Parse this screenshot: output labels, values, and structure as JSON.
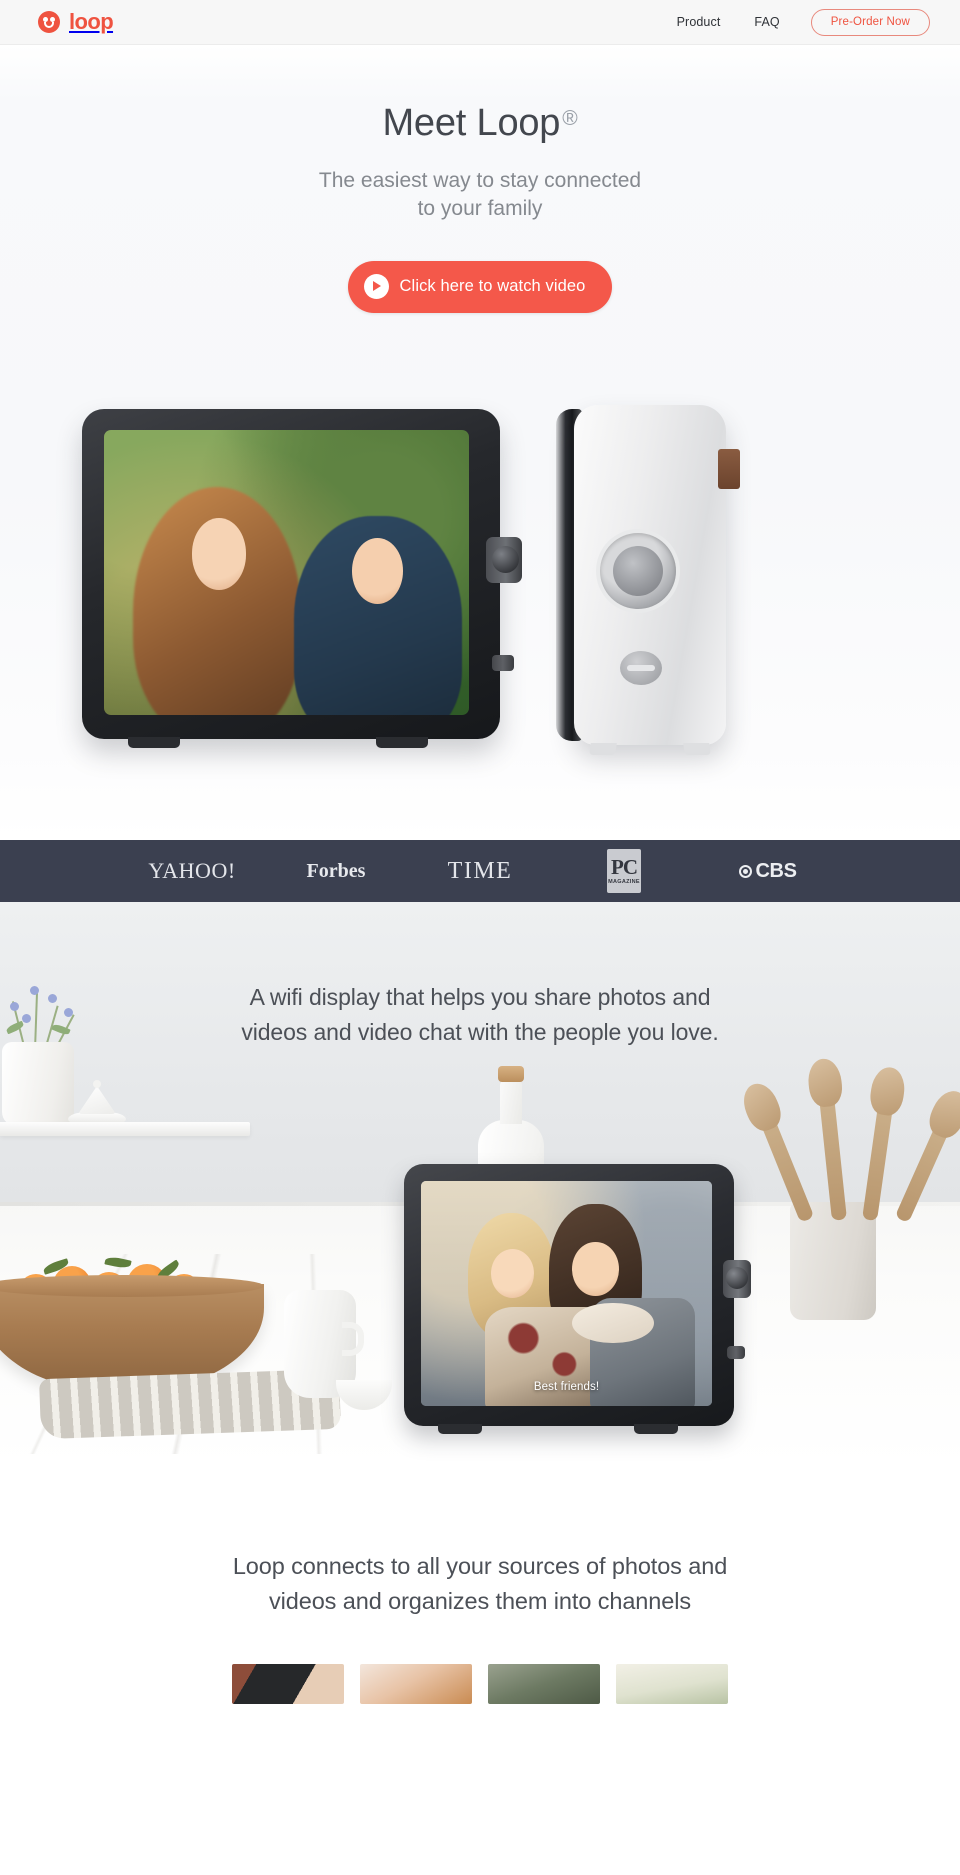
{
  "nav": {
    "logo_text": "loop",
    "logo_icon": "loop-smiley-icon",
    "links": [
      {
        "label": "Product"
      },
      {
        "label": "FAQ"
      }
    ],
    "cta_label": "Pre-Order Now"
  },
  "hero": {
    "title": "Meet Loop",
    "registered_mark": "®",
    "subtitle_line1": "The easiest way to stay connected",
    "subtitle_line2": "to your family",
    "video_button_label": "Click here to watch video",
    "play_icon": "play-icon",
    "product_photo_alt": "Loop device front view showing photo of two children, and white Loop device rear view"
  },
  "press": {
    "logos": [
      {
        "name": "yahoo-logo",
        "label": "YAHOO!"
      },
      {
        "name": "forbes-logo",
        "label": "Forbes"
      },
      {
        "name": "time-logo",
        "label": "TIME"
      },
      {
        "name": "pc-magazine-logo",
        "label": "PC",
        "sublabel": "MAGAZINE"
      },
      {
        "name": "cbs-logo",
        "label": "CBS"
      }
    ],
    "background_color": "#3b4050"
  },
  "features": {
    "headline_line1": "A wifi display that helps you share photos and",
    "headline_line2": "videos and video chat with the people you love.",
    "device_caption": "Best friends!",
    "scene_alt": "Loop display on a marble kitchen counter with a bowl of oranges, pitcher, bottle and wooden utensils"
  },
  "channels": {
    "headline_line1": "Loop connects to all your sources of photos and",
    "headline_line2": "videos and organizes them into channels",
    "thumbnails": [
      {
        "name": "thumbnail-woman-brick-wall"
      },
      {
        "name": "thumbnail-child-hat"
      },
      {
        "name": "thumbnail-vintage-car"
      },
      {
        "name": "thumbnail-landscape"
      }
    ]
  },
  "colors": {
    "brand": "#ef5340",
    "cta": "#f4584a",
    "press_bar": "#3b4050",
    "heading_text": "#43474e",
    "muted_text": "#85898f"
  }
}
